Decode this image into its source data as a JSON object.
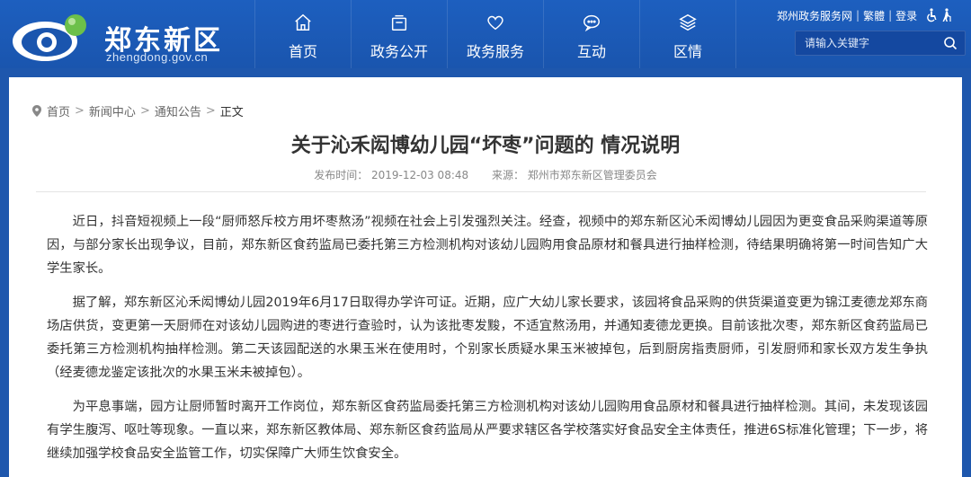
{
  "brand": {
    "name": "郑东新区",
    "domain": "zhengdong.gov.cn"
  },
  "nav": {
    "items": [
      {
        "label": "首页",
        "icon": "home-icon"
      },
      {
        "label": "政务公开",
        "icon": "document-stack-icon"
      },
      {
        "label": "政务服务",
        "icon": "heart-icon"
      },
      {
        "label": "互动",
        "icon": "chat-bubble-icon"
      },
      {
        "label": "区情",
        "icon": "layers-icon"
      }
    ]
  },
  "top_links": {
    "service_network": "郑州政务服务网",
    "traditional": "繁體",
    "login": "登录",
    "sep": "|"
  },
  "search": {
    "placeholder": "请输入关键字"
  },
  "breadcrumb": {
    "items": [
      "首页",
      "新闻中心",
      "通知公告",
      "正文"
    ],
    "sep": ">"
  },
  "article": {
    "title": "关于沁禾闳博幼儿园“坏枣”问题的 情况说明",
    "publish_time": "发布时间：  2019-12-03 08:48",
    "source": "来源：  郑州市郑东新区管理委员会",
    "paragraphs": [
      "近日，抖音短视频上一段“厨师怒斥校方用坏枣熬汤”视频在社会上引发强烈关注。经查，视频中的郑东新区沁禾闳博幼儿园因为更变食品采购渠道等原因，与部分家长出现争议，目前，郑东新区食药监局已委托第三方检测机构对该幼儿园购用食品原材和餐具进行抽样检测，待结果明确将第一时间告知广大学生家长。",
      "据了解，郑东新区沁禾闳博幼儿园2019年6月17日取得办学许可证。近期，应广大幼儿家长要求，该园将食品采购的供货渠道变更为锦江麦德龙郑东商场店供货，变更第一天厨师在对该幼儿园购进的枣进行查验时，认为该批枣发黢，不适宜熬汤用，并通知麦德龙更换。目前该批次枣，郑东新区食药监局已委托第三方检测机构抽样检测。第二天该园配送的水果玉米在使用时，个别家长质疑水果玉米被掉包，后到厨房指责厨师，引发厨师和家长双方发生争执（经麦德龙鉴定该批次的水果玉米未被掉包）。",
      "为平息事端，园方让厨师暂时离开工作岗位，郑东新区食药监局委托第三方检测机构对该幼儿园购用食品原材和餐具进行抽样检测。其间，未发现该园有学生腹泻、呕吐等现象。一直以来，郑东新区教体局、郑东新区食药监局从严要求辖区各学校落实好食品安全主体责任，推进6S标准化管理；下一步，将继续加强学校食品安全监管工作，切实保障广大师生饮食安全。"
    ]
  },
  "colors": {
    "header_bg": "#1a55ae",
    "page_bg": "#1e57ad",
    "text": "#333333",
    "meta": "#888888"
  }
}
